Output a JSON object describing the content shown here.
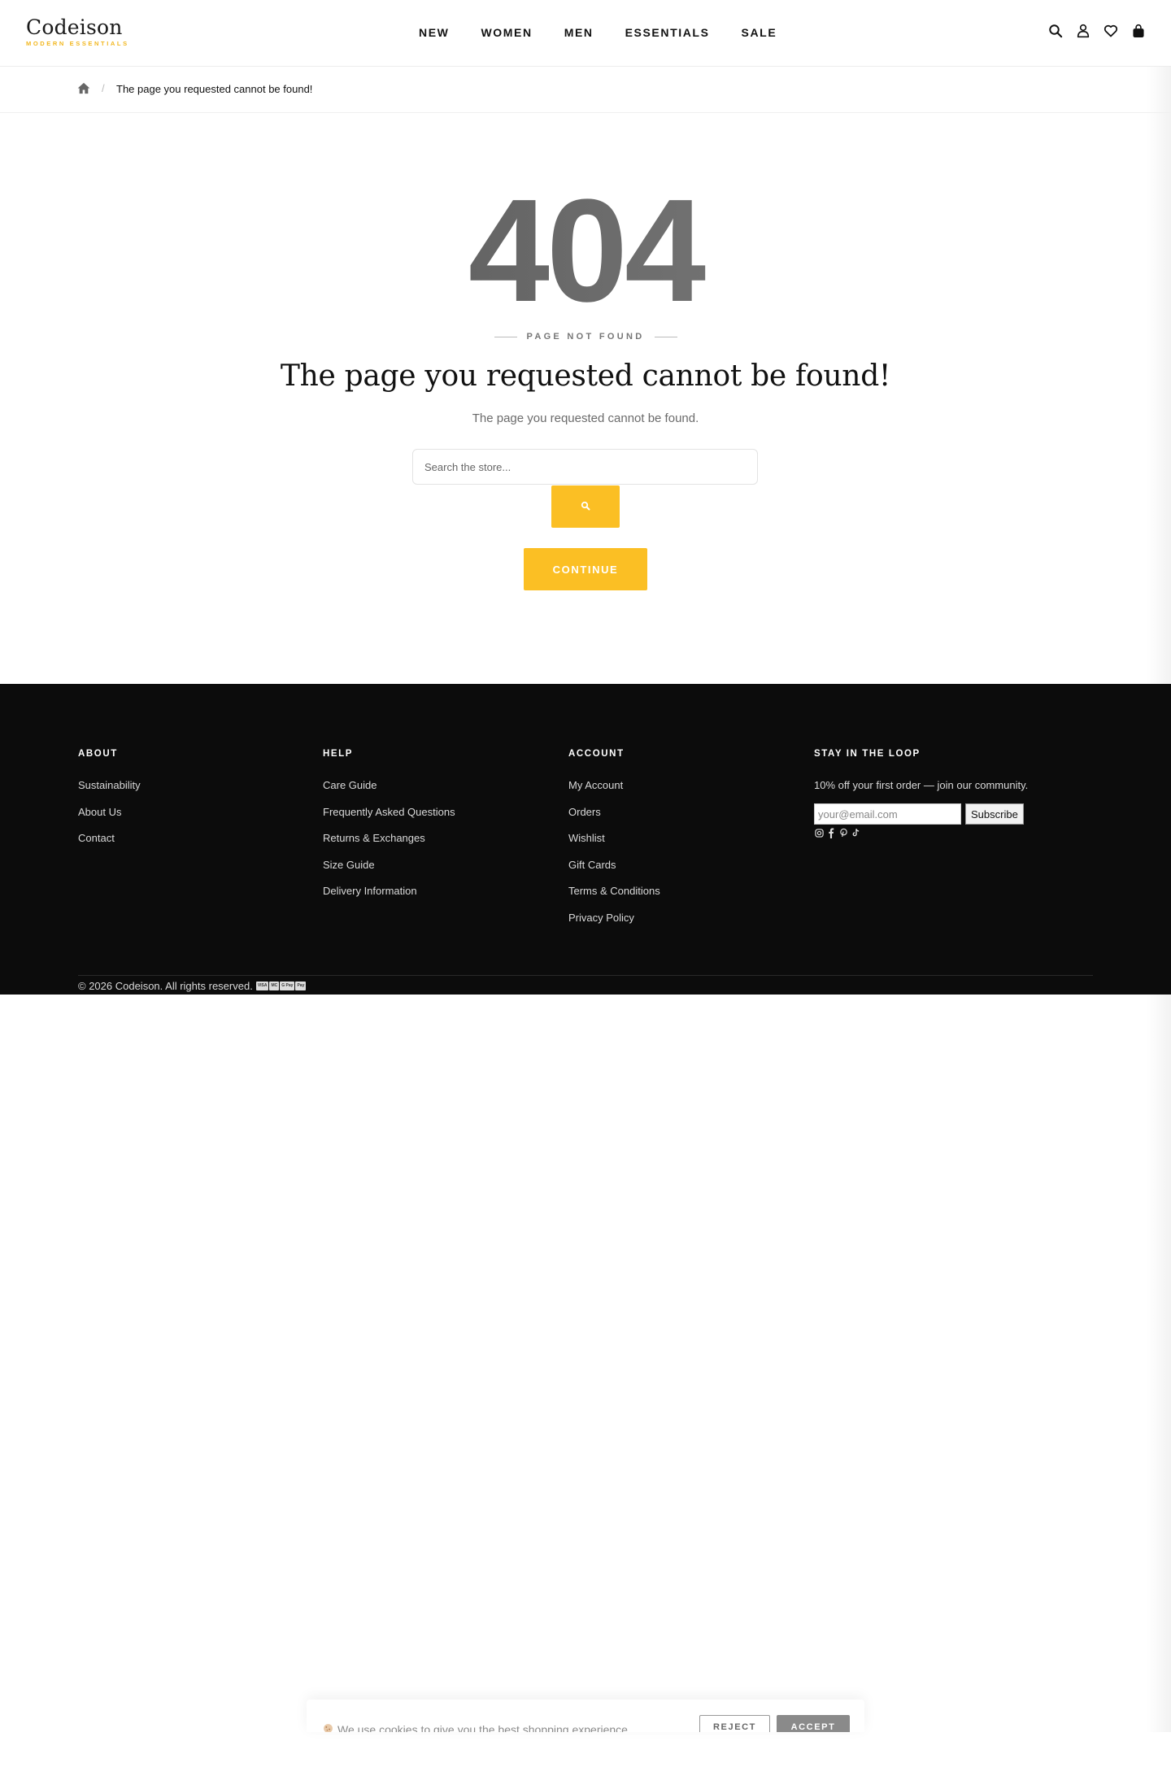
{
  "header": {
    "logo_name": "Codeison",
    "logo_tagline": "MODERN ESSENTIALS",
    "nav": [
      "NEW",
      "WOMEN",
      "MEN",
      "ESSENTIALS",
      "SALE"
    ],
    "icons": [
      "search-icon",
      "account-icon",
      "heart-icon",
      "bag-icon"
    ]
  },
  "breadcrumb": {
    "home_icon": "home-icon",
    "separator": "/",
    "current": "The page you requested cannot be found!"
  },
  "error": {
    "code": "404",
    "eyebrow": "PAGE NOT FOUND",
    "title": "The page you requested cannot be found!",
    "description": "The page you requested cannot be found.",
    "search_placeholder": "Search the store...",
    "continue_label": "CONTINUE"
  },
  "footer": {
    "columns": [
      {
        "heading": "ABOUT",
        "links": [
          "Sustainability",
          "About Us",
          "Contact"
        ]
      },
      {
        "heading": "HELP",
        "links": [
          "Care Guide",
          "Frequently Asked Questions",
          "Returns & Exchanges",
          "Size Guide",
          "Delivery Information"
        ]
      },
      {
        "heading": "ACCOUNT",
        "links": [
          "My Account",
          "Orders",
          "Wishlist",
          "Gift Cards",
          "Terms & Conditions",
          "Privacy Policy"
        ]
      }
    ],
    "newsletter": {
      "heading": "STAY IN THE LOOP",
      "text": "10% off your first order — join our community.",
      "email_placeholder": "your@email.com",
      "subscribe_label": "Subscribe",
      "social": [
        "instagram-icon",
        "facebook-icon",
        "pinterest-icon",
        "tiktok-icon"
      ]
    },
    "copyright": "© 2026 Codeison. All rights reserved.",
    "payment_badges": [
      "VISA",
      "MC",
      "G Pay",
      "Pay"
    ]
  },
  "cookie": {
    "message": "We use cookies to give you the best shopping experience.",
    "reject_label": "REJECT",
    "accept_label": "ACCEPT"
  },
  "colors": {
    "accent": "#fbbf24",
    "footer_bg": "#0c0c0c",
    "text": "#111111"
  }
}
